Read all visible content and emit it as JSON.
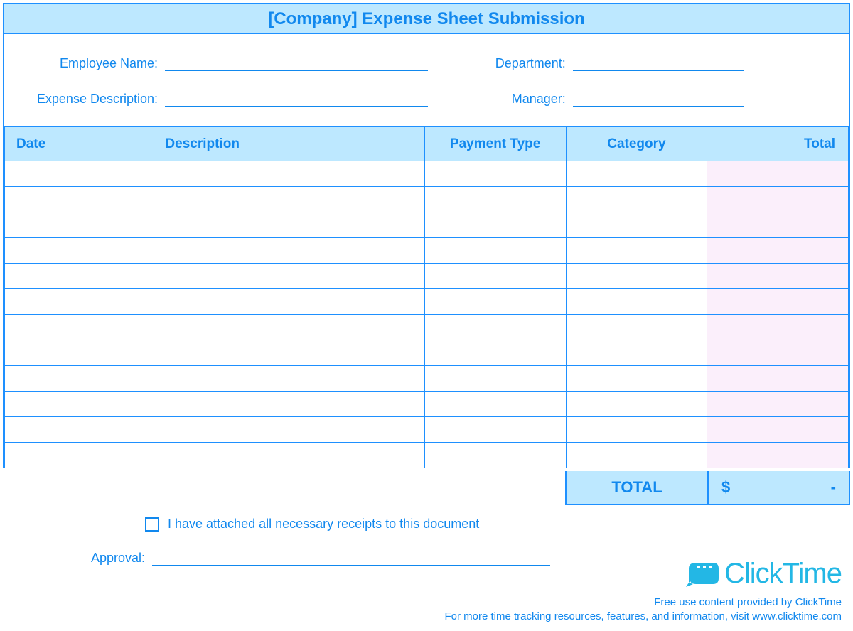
{
  "title": "[Company] Expense Sheet Submission",
  "fields": {
    "employee_name_label": "Employee Name:",
    "employee_name_value": "",
    "department_label": "Department:",
    "department_value": "",
    "expense_desc_label": "Expense Description:",
    "expense_desc_value": "",
    "manager_label": "Manager:",
    "manager_value": "",
    "approval_label": "Approval:",
    "approval_value": ""
  },
  "columns": {
    "date": "Date",
    "description": "Description",
    "payment_type": "Payment Type",
    "category": "Category",
    "total": "Total"
  },
  "rows": [
    {
      "date": "",
      "description": "",
      "payment_type": "",
      "category": "",
      "total": ""
    },
    {
      "date": "",
      "description": "",
      "payment_type": "",
      "category": "",
      "total": ""
    },
    {
      "date": "",
      "description": "",
      "payment_type": "",
      "category": "",
      "total": ""
    },
    {
      "date": "",
      "description": "",
      "payment_type": "",
      "category": "",
      "total": ""
    },
    {
      "date": "",
      "description": "",
      "payment_type": "",
      "category": "",
      "total": ""
    },
    {
      "date": "",
      "description": "",
      "payment_type": "",
      "category": "",
      "total": ""
    },
    {
      "date": "",
      "description": "",
      "payment_type": "",
      "category": "",
      "total": ""
    },
    {
      "date": "",
      "description": "",
      "payment_type": "",
      "category": "",
      "total": ""
    },
    {
      "date": "",
      "description": "",
      "payment_type": "",
      "category": "",
      "total": ""
    },
    {
      "date": "",
      "description": "",
      "payment_type": "",
      "category": "",
      "total": ""
    },
    {
      "date": "",
      "description": "",
      "payment_type": "",
      "category": "",
      "total": ""
    },
    {
      "date": "",
      "description": "",
      "payment_type": "",
      "category": "",
      "total": ""
    }
  ],
  "totals": {
    "label": "TOTAL",
    "currency": "$",
    "value": "-"
  },
  "receipts_checkbox": {
    "checked": false,
    "label": "I have attached all necessary receipts to this document"
  },
  "brand": {
    "name": "ClickTime",
    "credit1": "Free use content provided by ClickTime",
    "credit2": "For more time tracking resources, features, and information, visit www.clicktime.com"
  }
}
